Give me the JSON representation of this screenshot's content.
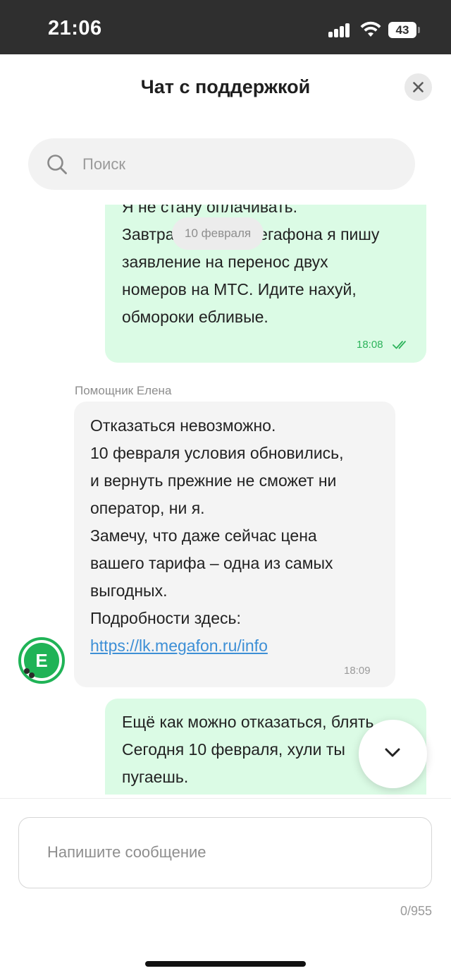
{
  "status_bar": {
    "time": "21:06",
    "battery": "43"
  },
  "header": {
    "title": "Чат с поддержкой"
  },
  "search": {
    "placeholder": "Поиск"
  },
  "chat": {
    "date_pill": "10 февраля",
    "messages": [
      {
        "direction": "out",
        "lines": [
          "Я не стану оплачивать.",
          "Завтра в офисе Мегафона я пишу",
          "заявление на перенос двух",
          "номеров на МТС. Идите нахуй,",
          "обмороки ебливые."
        ],
        "time": "18:08",
        "status": "read"
      },
      {
        "direction": "in",
        "sender": "Помощник Елена",
        "lines": [
          "Отказаться невозможно.",
          "10 февраля условия обновились,",
          "и вернуть прежние не сможет ни",
          "оператор, ни я.",
          "Замечу, что даже сейчас цена",
          "вашего тарифа – одна из самых",
          "выгодных.",
          "Подробности здесь:"
        ],
        "link": "https://lk.megafon.ru/info",
        "time": "18:09",
        "avatar_letter": "E"
      },
      {
        "direction": "out",
        "lines": [
          "Ещё как можно отказаться, блять",
          "Сегодня 10 февраля, хули ты",
          "пугаешь."
        ]
      }
    ]
  },
  "composer": {
    "placeholder": "Напишите сообщение",
    "counter": "0/955"
  },
  "colors": {
    "outgoing_bubble": "#dbfbe5",
    "incoming_bubble": "#f4f4f4",
    "brand_green": "#1fb356",
    "link": "#3d8fd6"
  }
}
